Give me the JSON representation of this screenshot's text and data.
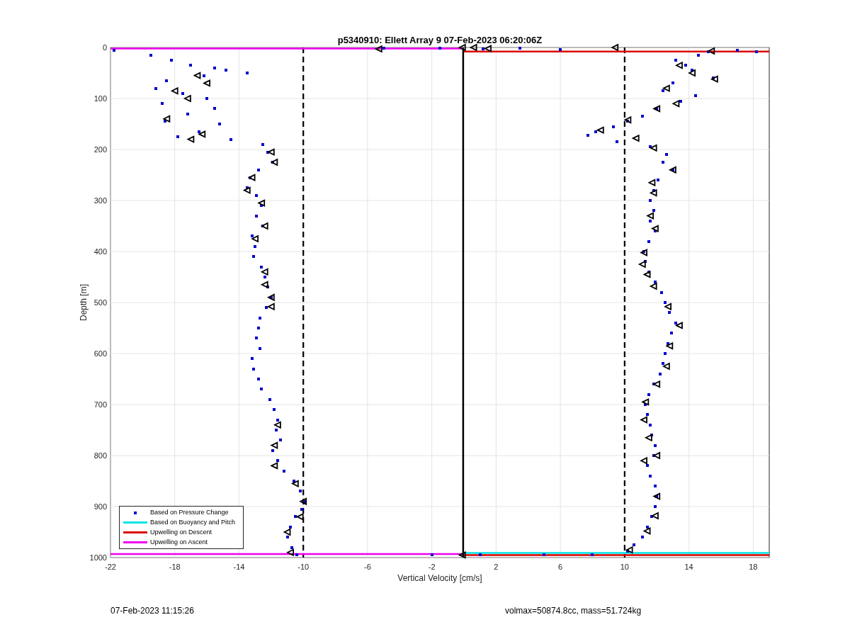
{
  "figure": {
    "chart_data": {
      "type": "scatter",
      "title": "p5340910: Ellett Array 9 07-Feb-2023 06:20:06Z",
      "xlabel": "Vertical Velocity [cm/s]",
      "ylabel": "Depth [m]",
      "xlim": [
        -22,
        19
      ],
      "ylim": [
        1000,
        0
      ],
      "xticks": [
        -22,
        -18,
        -14,
        -10,
        -6,
        -2,
        2,
        6,
        10,
        14,
        18
      ],
      "yticks": [
        0,
        100,
        200,
        300,
        400,
        500,
        600,
        700,
        800,
        900,
        1000
      ],
      "series": [
        {
          "name": "Based on Pressure Change",
          "type": "scatter",
          "marker": "square",
          "color": "#0000cc",
          "x": [
            -21.8,
            -19.5,
            -18.2,
            -17,
            -15.5,
            -14.8,
            -13.5,
            -16.2,
            -18.5,
            -19.2,
            -17.5,
            -16,
            -18.8,
            -15.5,
            -17.2,
            -18.6,
            -15.2,
            -16.5,
            -17.8,
            -14.5,
            -12.5,
            -12.2,
            -11.9,
            -12.8,
            -13.3,
            -13.5,
            -12.9,
            -12.6,
            -12.9,
            -12.5,
            -13.2,
            -13,
            -13.1,
            -12.6,
            -12.4,
            -12.2,
            -12,
            -12.3,
            -12.7,
            -12.8,
            -12.9,
            -12.7,
            -13.2,
            -13.1,
            -12.8,
            -12.6,
            -12.1,
            -11.8,
            -11.6,
            -11.7,
            -11.4,
            -11.9,
            -11.6,
            -11.2,
            -10.6,
            -10.2,
            -9.9,
            -10.1,
            -10.5,
            -10.8,
            -11,
            -10.7,
            -10.4,
            -5,
            -1.5,
            1.2,
            3.5,
            6,
            17,
            18.2,
            15.2,
            14.6,
            13.2,
            13.8,
            14.2,
            15.5,
            13,
            12.4,
            14.4,
            13.5,
            12,
            11.1,
            10.2,
            9.3,
            8.2,
            7.7,
            9.5,
            11.6,
            12.6,
            12.4,
            13,
            12.1,
            11.8,
            11.6,
            11.8,
            11.6,
            11.9,
            11.5,
            11.2,
            11.3,
            11.5,
            11.9,
            12.3,
            12.5,
            12.8,
            13.2,
            12.9,
            12.7,
            12.5,
            12.4,
            12.2,
            11.8,
            11.5,
            11.3,
            11.4,
            11.6,
            11.7,
            11.9,
            11.8,
            11.4,
            11.6,
            11.9,
            12,
            11.9,
            11.7,
            11.4,
            11.1,
            10.6,
            10.2,
            -2,
            1,
            5,
            8
          ],
          "values": [
            5,
            15,
            25,
            35,
            40,
            45,
            50,
            55,
            65,
            80,
            90,
            100,
            110,
            120,
            130,
            145,
            150,
            165,
            175,
            180,
            190,
            205,
            225,
            240,
            255,
            275,
            290,
            310,
            330,
            350,
            370,
            390,
            410,
            430,
            450,
            470,
            490,
            510,
            530,
            550,
            570,
            590,
            610,
            630,
            650,
            670,
            690,
            710,
            730,
            750,
            770,
            790,
            810,
            830,
            850,
            870,
            890,
            905,
            920,
            940,
            960,
            980,
            995,
            2,
            2,
            3,
            2,
            4,
            6,
            8,
            8,
            15,
            25,
            35,
            45,
            60,
            70,
            85,
            95,
            105,
            120,
            135,
            145,
            155,
            165,
            172,
            185,
            195,
            210,
            225,
            240,
            260,
            280,
            300,
            320,
            340,
            360,
            380,
            400,
            420,
            440,
            460,
            480,
            500,
            520,
            540,
            560,
            580,
            600,
            620,
            640,
            660,
            680,
            700,
            720,
            740,
            760,
            780,
            800,
            820,
            840,
            860,
            880,
            900,
            920,
            940,
            960,
            975,
            988,
            995,
            994,
            995,
            994
          ]
        },
        {
          "name": "Based on Buoyancy and Pitch",
          "type": "line",
          "color": "#00e5e5",
          "x": [
            0,
            19
          ],
          "values": [
            991,
            991
          ]
        },
        {
          "name": "Upwelling on Descent",
          "type": "line",
          "color": "#dd0000",
          "x": [
            0,
            19
          ],
          "values": [
            8,
            8
          ]
        },
        {
          "name": "Upwelling on Ascent",
          "type": "line",
          "color": "#ee00ee",
          "x": [
            -22,
            0
          ],
          "values": [
            2,
            2
          ]
        },
        {
          "type": "line",
          "color": "#dd0000",
          "x": [
            0,
            19
          ],
          "values": [
            995,
            995
          ]
        },
        {
          "type": "line",
          "color": "#ee00ee",
          "x": [
            -22,
            0
          ],
          "values": [
            993,
            993
          ]
        },
        {
          "type": "line",
          "color": "#000000",
          "x": [
            -0.05,
            -0.05
          ],
          "values": [
            0,
            1000
          ]
        },
        {
          "type": "scatter",
          "marker": "triangle",
          "color": "#000000",
          "x": [
            -16.6,
            -16,
            -18,
            -17.2,
            -18.5,
            -16.3,
            -17,
            -12,
            -11.8,
            -13.2,
            -13.5,
            -12.6,
            -12.4,
            -13,
            -12.4,
            -12.4,
            -12,
            -12,
            -11.6,
            -11.8,
            -11.8,
            -10.5,
            -10,
            -10.2,
            -11,
            -10.8,
            -5.3,
            -0.1,
            15.4,
            13.4,
            14.2,
            15.6,
            12.6,
            12,
            13.2,
            10.2,
            8.5,
            10.7,
            11.8,
            13,
            11.7,
            11.8,
            11.6,
            11.9,
            11.2,
            11.1,
            11.4,
            11.8,
            12.7,
            13.4,
            12.8,
            12.6,
            12,
            11.3,
            11.2,
            11.5,
            12,
            11.2,
            12,
            11.9,
            11.4,
            10.3,
            9.4,
            1.5,
            0.6,
            -0.1
          ],
          "values": [
            55,
            70,
            85,
            100,
            140,
            170,
            180,
            205,
            225,
            255,
            280,
            305,
            350,
            375,
            440,
            465,
            490,
            508,
            740,
            780,
            820,
            855,
            890,
            920,
            950,
            990,
            3,
            0,
            7,
            35,
            50,
            62,
            80,
            120,
            110,
            142,
            162,
            178,
            197,
            240,
            265,
            285,
            330,
            355,
            402,
            425,
            445,
            468,
            508,
            545,
            585,
            625,
            660,
            695,
            730,
            765,
            800,
            810,
            880,
            918,
            948,
            985,
            0,
            2,
            0,
            995
          ]
        }
      ],
      "ref_lines": [
        {
          "axis": "x",
          "value": -10
        },
        {
          "axis": "x",
          "value": 10
        }
      ],
      "grid": true,
      "legend": "lower left"
    }
  },
  "footer": {
    "timestamp": "07-Feb-2023 11:15:26",
    "summary": "volmax=50874.8cc, mass=51.724kg"
  }
}
